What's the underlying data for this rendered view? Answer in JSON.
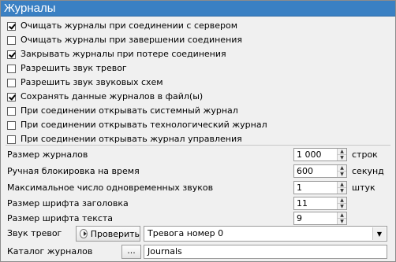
{
  "header": {
    "title": "Журналы"
  },
  "checkboxes": [
    {
      "label": "Очищать журналы при соединении с сервером",
      "checked": true
    },
    {
      "label": "Очищать журналы при завершении соединения",
      "checked": false
    },
    {
      "label": "Закрывать журналы при потере соединения",
      "checked": true
    },
    {
      "label": "Разрешить звук тревог",
      "checked": false
    },
    {
      "label": "Разрешить звук звуковых схем",
      "checked": false
    },
    {
      "label": "Сохранять данные журналов в файл(ы)",
      "checked": true
    },
    {
      "label": "При соединении открывать системный журнал",
      "checked": false
    },
    {
      "label": "При соединении открывать технологический журнал",
      "checked": false
    },
    {
      "label": "При соединении открывать журнал управления",
      "checked": false
    }
  ],
  "numeric": [
    {
      "label": "Размер журналов",
      "value": "1 000",
      "unit": "строк"
    },
    {
      "label": "Ручная блокировка на время",
      "value": "600",
      "unit": "секунд"
    },
    {
      "label": "Максимальное число одновременных звуков",
      "value": "1",
      "unit": "штук"
    },
    {
      "label": "Размер шрифта заголовка",
      "value": "11",
      "unit": ""
    },
    {
      "label": "Размер шрифта текста",
      "value": "9",
      "unit": ""
    }
  ],
  "alarm_sound": {
    "label": "Звук тревог",
    "test_button": "Проверить",
    "selected": "Тревога номер 0"
  },
  "log_dir": {
    "label": "Каталог журналов",
    "browse_button": "...",
    "value": "Journals"
  }
}
